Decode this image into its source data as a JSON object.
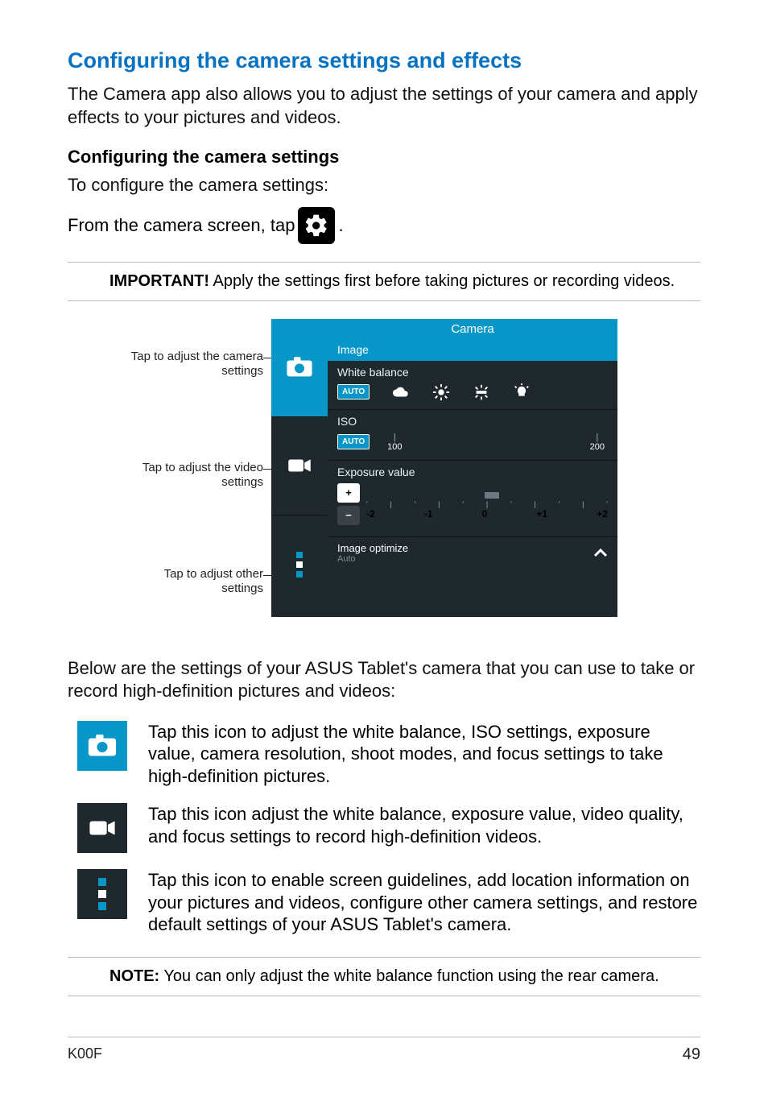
{
  "heading1": "Configuring the camera settings and effects",
  "intro": "The Camera app also allows you to adjust the settings of your camera and apply effects to your pictures and videos.",
  "heading2": "Configuring the camera settings",
  "para2": "To configure the camera settings:",
  "inline_prefix": "From the camera screen, tap ",
  "inline_suffix": ".",
  "callout_important_label": "IMPORTANT!",
  "callout_important_text": "  Apply the settings first before taking pictures or recording videos.",
  "annotations": {
    "camera": "Tap to adjust the camera settings",
    "video": "Tap to adjust the video settings",
    "other": "Tap to adjust other settings"
  },
  "shot": {
    "title": "Camera",
    "tab_image": "Image",
    "wb_label": "White balance",
    "wb_auto": "AUTO",
    "iso_label": "ISO",
    "iso_auto": "AUTO",
    "iso_100": "100",
    "iso_200": "200",
    "ev_label": "Exposure value",
    "ev_m2": "-2",
    "ev_m1": "-1",
    "ev_0": "0",
    "ev_p1": "+1",
    "ev_p2": "+2",
    "opt_label": "Image optimize",
    "opt_sub": "Auto"
  },
  "below_para": "Below are the settings of your ASUS Tablet's camera that you can use to take or record high-definition pictures and videos:",
  "iconlist": {
    "camera": "Tap this icon to adjust the white balance, ISO settings, exposure value, camera resolution, shoot modes, and focus settings to take high-definition pictures.",
    "video": "Tap this icon adjust the white balance, exposure value, video quality, and focus settings to record high-definition videos.",
    "other": "Tap this icon to enable screen guidelines, add location information on your pictures and videos, configure other camera settings, and restore default settings of your ASUS Tablet's camera."
  },
  "callout_note_label": "NOTE:",
  "callout_note_text": "  You can only adjust the white balance function using the rear camera.",
  "footer_model": "K00F",
  "footer_page": "49"
}
